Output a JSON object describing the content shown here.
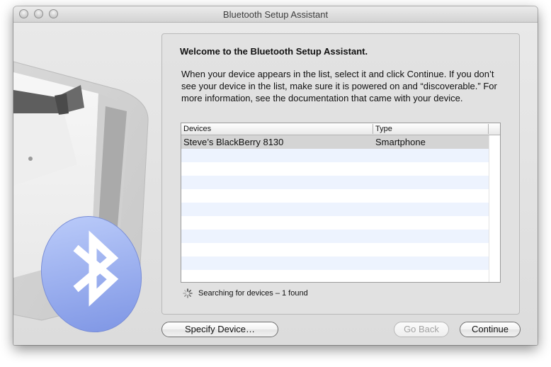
{
  "window": {
    "title": "Bluetooth Setup Assistant"
  },
  "content": {
    "heading": "Welcome to the Bluetooth Setup Assistant.",
    "description": "When your device appears in the list, select it and click Continue. If you don’t see your device in the list, make sure it is powered on and “discoverable.” For more information, see the documentation that came with your device."
  },
  "table": {
    "columns": [
      "Devices",
      "Type"
    ],
    "rows": [
      {
        "device": "Steve’s BlackBerry 8130",
        "type": "Smartphone",
        "selected": true
      }
    ]
  },
  "status": {
    "text": "Searching for devices – 1 found"
  },
  "buttons": {
    "specify": "Specify Device…",
    "back": "Go Back",
    "continue": "Continue"
  },
  "icons": {
    "bluetooth_badge": "bluetooth-icon",
    "tuxedo_art": "tuxedo-illustration",
    "spinner": "spinner-icon"
  },
  "colors": {
    "bluetooth_blue": "#8fa8f0",
    "selection_gray": "#d4d4d4",
    "stripe_blue": "#edf3fe"
  }
}
